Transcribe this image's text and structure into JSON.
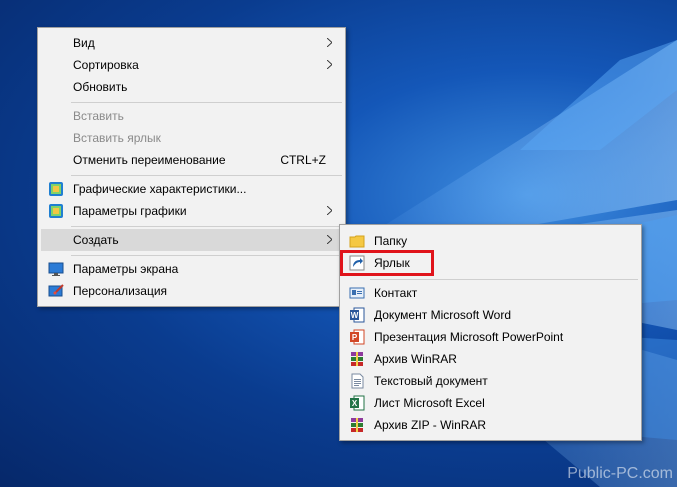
{
  "main_menu": {
    "items": [
      {
        "label": "Вид"
      },
      {
        "label": "Сортировка"
      },
      {
        "label": "Обновить"
      },
      {
        "label": "Вставить"
      },
      {
        "label": "Вставить ярлык"
      },
      {
        "label": "Отменить переименование",
        "shortcut": "CTRL+Z"
      },
      {
        "label": "Графические характеристики..."
      },
      {
        "label": "Параметры графики"
      },
      {
        "label": "Создать"
      },
      {
        "label": "Параметры экрана"
      },
      {
        "label": "Персонализация"
      }
    ]
  },
  "sub_menu": {
    "items": [
      {
        "label": "Папку",
        "icon": "folder-icon"
      },
      {
        "label": "Ярлык",
        "icon": "shortcut-icon"
      },
      {
        "label": "Контакт",
        "icon": "contact-icon"
      },
      {
        "label": "Документ Microsoft Word",
        "icon": "word-icon"
      },
      {
        "label": "Презентация Microsoft PowerPoint",
        "icon": "powerpoint-icon"
      },
      {
        "label": "Архив WinRAR",
        "icon": "winrar-icon"
      },
      {
        "label": "Текстовый документ",
        "icon": "text-document-icon"
      },
      {
        "label": "Лист Microsoft Excel",
        "icon": "excel-icon"
      },
      {
        "label": "Архив ZIP - WinRAR",
        "icon": "winrar-zip-icon"
      }
    ]
  },
  "watermark": "Public-PC.com",
  "colors": {
    "highlight": "#e0141b",
    "menu_bg": "#f2f2f2",
    "active_bg": "#d9d9d9"
  }
}
